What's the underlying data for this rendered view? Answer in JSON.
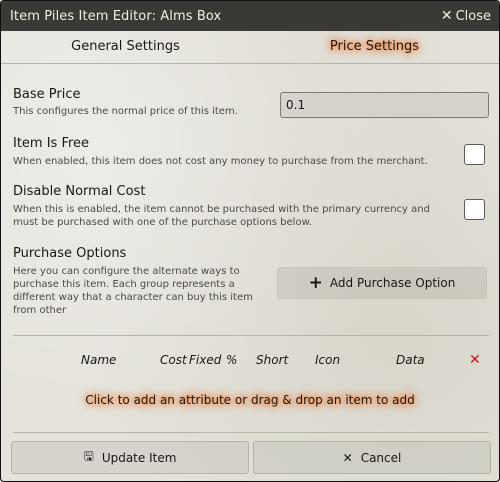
{
  "window": {
    "title": "Item Piles Item Editor: Alms Box",
    "close_label": "Close"
  },
  "tabs": [
    {
      "label": "General Settings",
      "active": false
    },
    {
      "label": "Price Settings",
      "active": true
    }
  ],
  "price": {
    "base_price": {
      "label": "Base Price",
      "hint": "This configures the normal price of this item.",
      "value": "0.1"
    },
    "is_free": {
      "label": "Item Is Free",
      "hint": "When enabled, this item does not cost any money to purchase from the merchant.",
      "checked": false
    },
    "disable_normal_cost": {
      "label": "Disable Normal Cost",
      "hint": "When this is enabled, the item cannot be purchased with the primary currency and must be purchased with one of the purchase options below.",
      "checked": false
    },
    "purchase_options": {
      "label": "Purchase Options",
      "hint": "Here you can configure the alternate ways to purchase this item. Each group represents a different way that a character can buy this item from other",
      "add_button_label": "Add Purchase Option"
    }
  },
  "table": {
    "columns": [
      "Name",
      "Cost",
      "Fixed",
      "%",
      "Short",
      "Icon",
      "Data"
    ],
    "empty_message": "Click to add an attribute or drag & drop an item to add"
  },
  "footer": {
    "update_label": "Update Item",
    "cancel_label": "Cancel"
  },
  "colors": {
    "titlebar": "#3a3936",
    "highlight_glow": "#ff6400",
    "delete": "#dd1111"
  },
  "icons": {
    "close": "close-icon",
    "add": "plus-icon",
    "delete": "x-icon",
    "save": "save-icon",
    "cancel": "close-icon"
  }
}
